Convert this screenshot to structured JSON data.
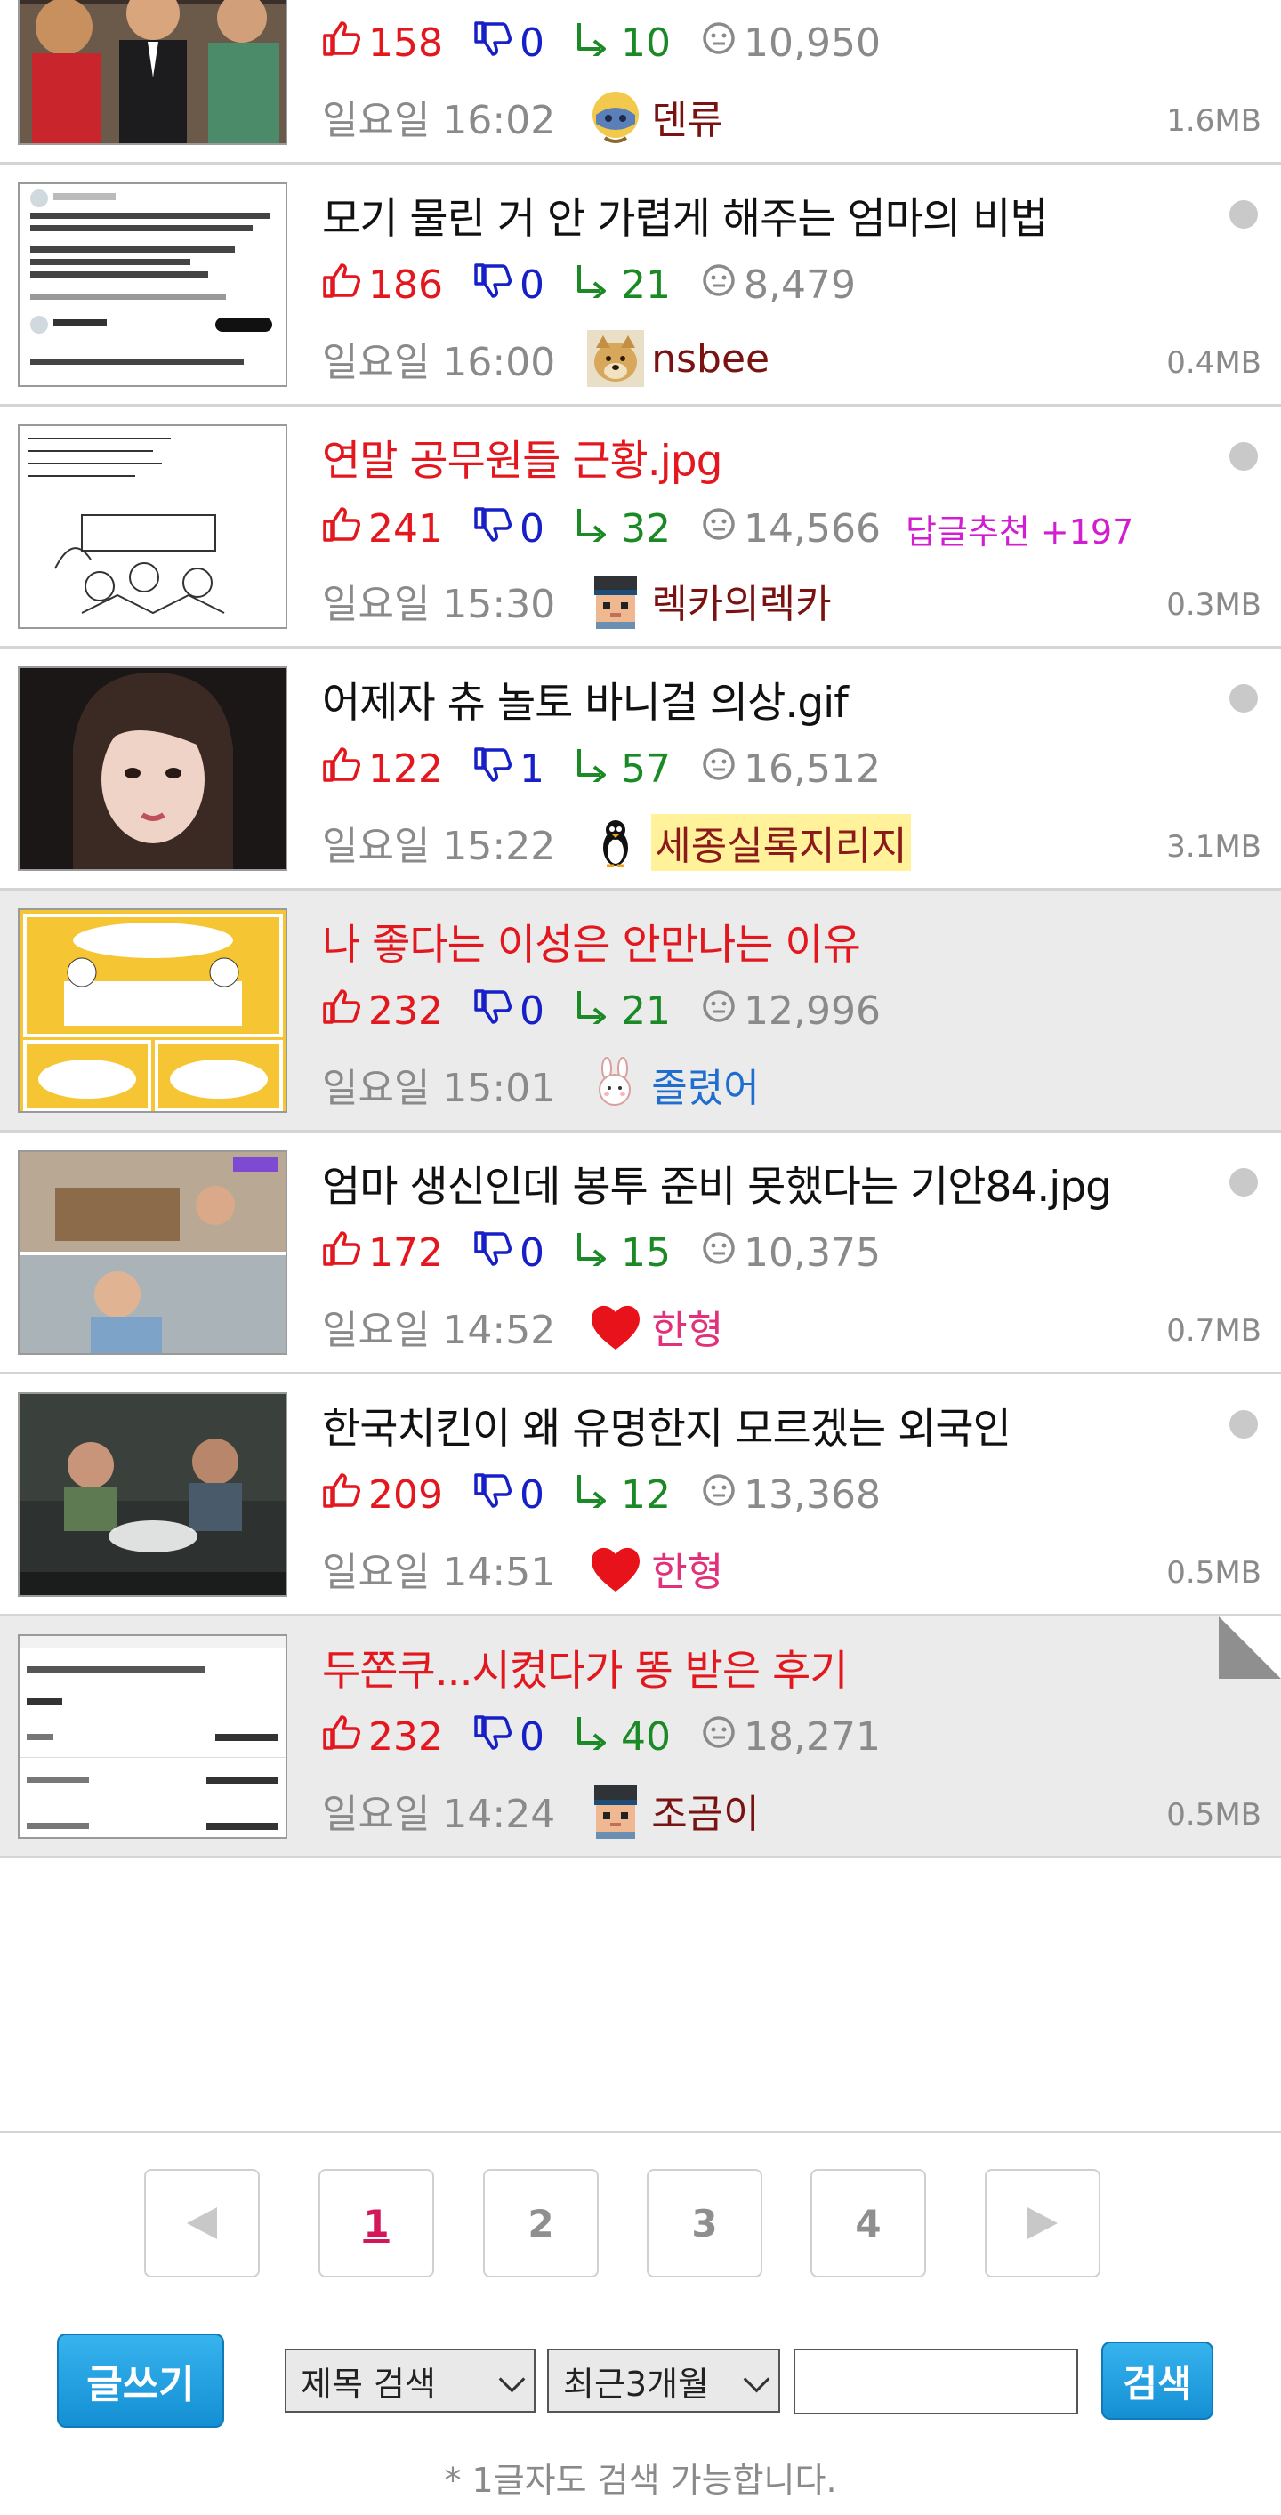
{
  "posts": [
    {
      "title": "",
      "title_color": "black",
      "up": "158",
      "down": "0",
      "replies": "10",
      "views": "10,950",
      "recommend": "",
      "date": "일요일 16:02",
      "user": "덴류",
      "user_style": "dark",
      "avatar": "mask",
      "size": "1.6MB",
      "marker": "none",
      "bg": "white",
      "thumb": "photo-people"
    },
    {
      "title": "모기 물린 거 안 가렵게 해주는 엄마의 비법",
      "title_color": "black",
      "up": "186",
      "down": "0",
      "replies": "21",
      "views": "8,479",
      "recommend": "",
      "date": "일요일 16:00",
      "user": "nsbee",
      "user_style": "dark",
      "avatar": "dog",
      "size": "0.4MB",
      "marker": "dot",
      "bg": "white",
      "thumb": "tweet"
    },
    {
      "title": "연말 공무원들 근황.jpg",
      "title_color": "red",
      "up": "241",
      "down": "0",
      "replies": "32",
      "views": "14,566",
      "recommend": "답글추천 +197",
      "date": "일요일 15:30",
      "user": "렉카의렉카",
      "user_style": "dark",
      "avatar": "pixel",
      "size": "0.3MB",
      "marker": "dot",
      "bg": "white",
      "thumb": "sketch"
    },
    {
      "title": "어제자 츄 놀토 바니걸 의상.gif",
      "title_color": "black",
      "up": "122",
      "down": "1",
      "replies": "57",
      "views": "16,512",
      "recommend": "",
      "date": "일요일 15:22",
      "user": "세종실록지리지",
      "user_style": "highlight",
      "avatar": "penguin",
      "size": "3.1MB",
      "marker": "dot",
      "bg": "white",
      "thumb": "portrait"
    },
    {
      "title": "나 좋다는 이성은 안만나는 이유",
      "title_color": "red",
      "up": "232",
      "down": "0",
      "replies": "21",
      "views": "12,996",
      "recommend": "",
      "date": "일요일 15:01",
      "user": "졸렸어",
      "user_style": "blue",
      "avatar": "bunny",
      "size": "",
      "marker": "none",
      "bg": "gray",
      "thumb": "comic-yellow"
    },
    {
      "title": "엄마 생신인데 봉투 준비 못했다는 기안84.jpg",
      "title_color": "black",
      "up": "172",
      "down": "0",
      "replies": "15",
      "views": "10,375",
      "recommend": "",
      "date": "일요일 14:52",
      "user": "한형",
      "user_style": "pink",
      "avatar": "heart",
      "size": "0.7MB",
      "marker": "dot",
      "bg": "white",
      "thumb": "tv-split"
    },
    {
      "title": "한국치킨이 왜 유명한지 모르겠는 외국인",
      "title_color": "black",
      "up": "209",
      "down": "0",
      "replies": "12",
      "views": "13,368",
      "recommend": "",
      "date": "일요일 14:51",
      "user": "한형",
      "user_style": "pink",
      "avatar": "heart",
      "size": "0.5MB",
      "marker": "dot",
      "bg": "white",
      "thumb": "tv-dark"
    },
    {
      "title": "두쫀쿠...시켰다가 똥 받은 후기",
      "title_color": "red",
      "up": "232",
      "down": "0",
      "replies": "40",
      "views": "18,271",
      "recommend": "",
      "date": "일요일 14:24",
      "user": "조곰이",
      "user_style": "dark",
      "avatar": "pixel",
      "size": "0.5MB",
      "marker": "fold",
      "bg": "gray",
      "thumb": "shop"
    }
  ],
  "pagination": {
    "prev": "◀",
    "pages": [
      "1",
      "2",
      "3",
      "4"
    ],
    "current": "1",
    "next": "▶"
  },
  "search": {
    "write_label": "글쓰기",
    "field_select": "제목 검색",
    "period_select": "최근3개월",
    "query_value": "",
    "button_label": "검색",
    "hint": "* 1글자도 검색 가능합니다."
  },
  "colors": {
    "accent": "#1a9be0",
    "red": "#e3171e",
    "blue": "#1720c7",
    "green": "#1b8a26",
    "magenta": "#d11ed1"
  },
  "icons": {
    "up": "thumb-up-icon",
    "down": "thumb-down-icon",
    "reply": "reply-arrow-icon",
    "views": "eye-icon"
  }
}
